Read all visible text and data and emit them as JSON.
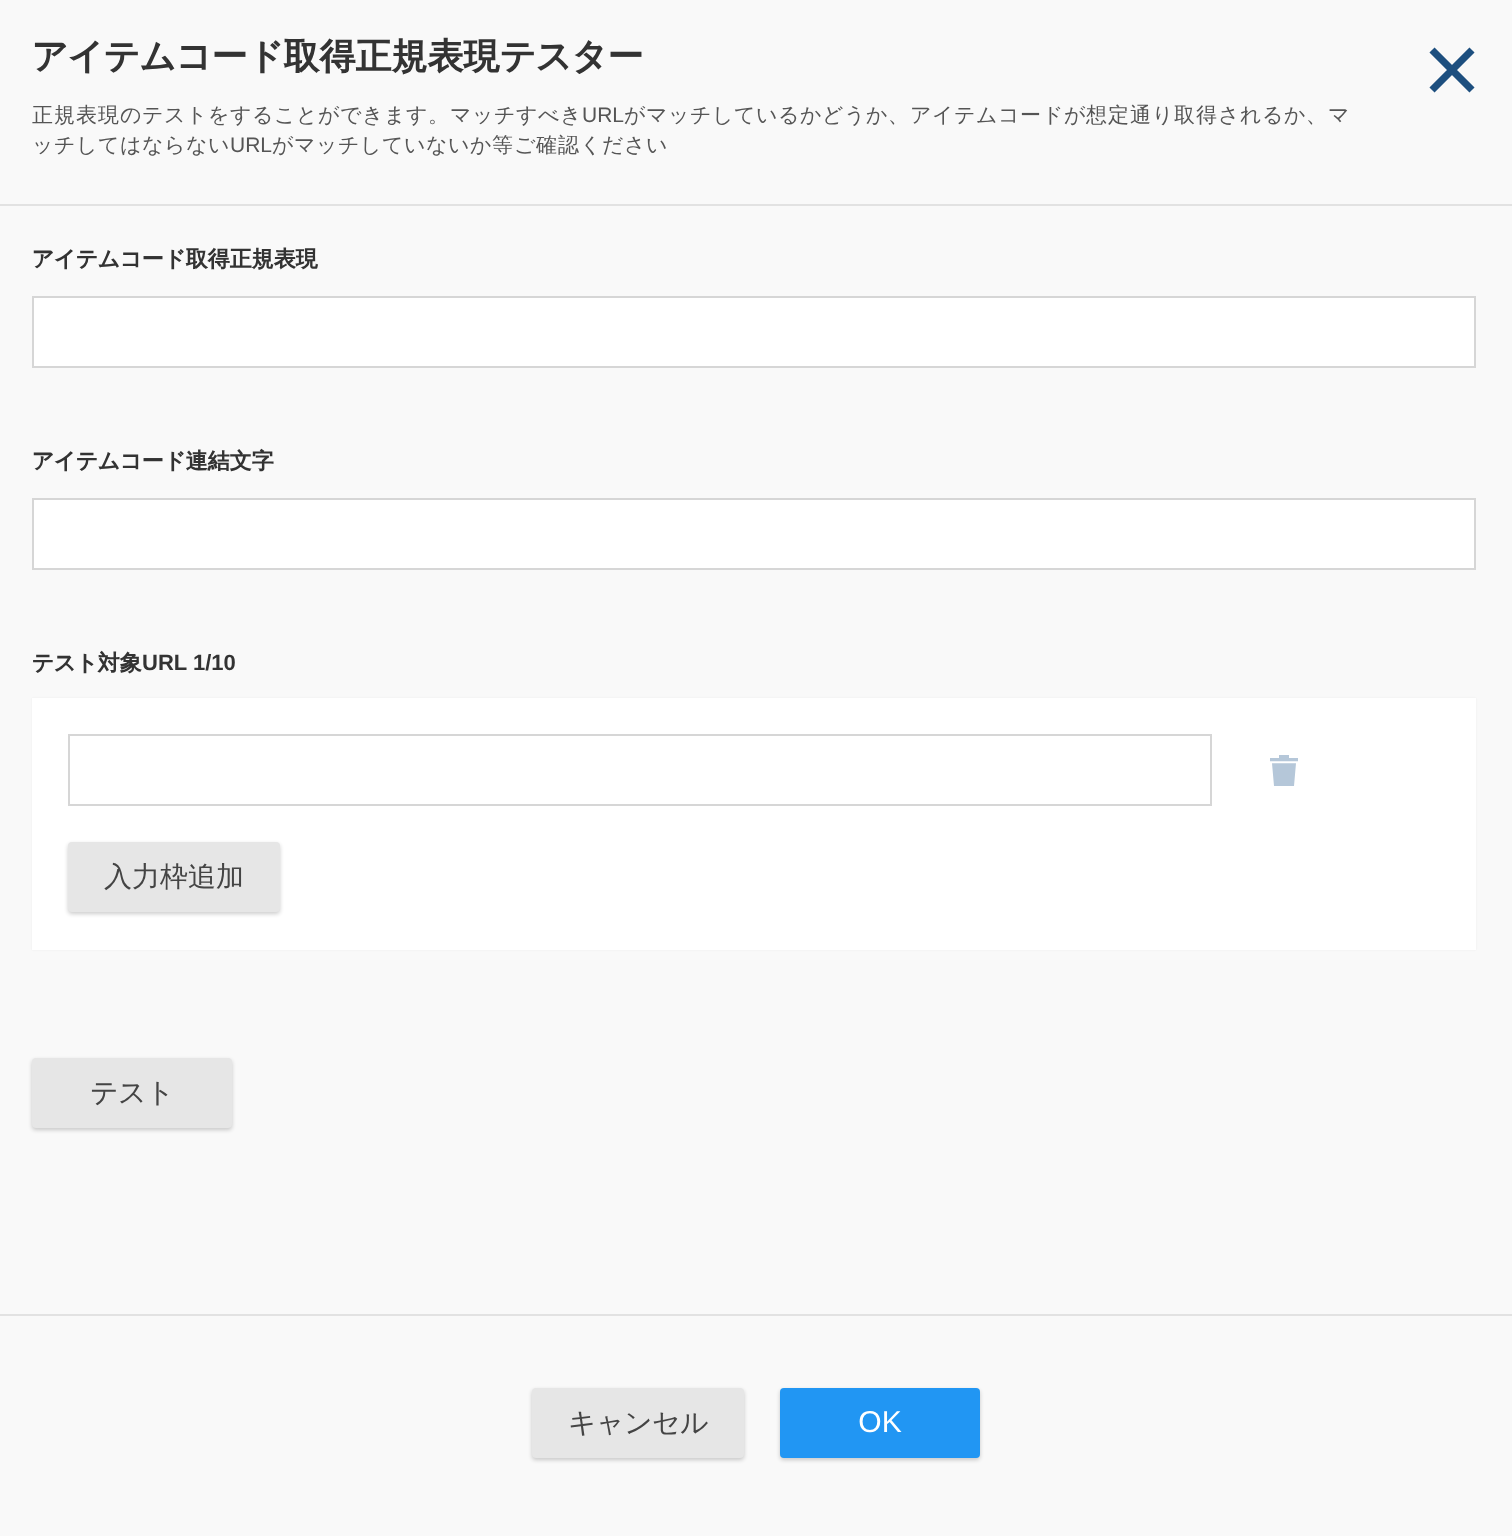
{
  "dialog": {
    "title": "アイテムコード取得正規表現テスター",
    "description": "正規表現のテストをすることができます。マッチすべきURLがマッチしているかどうか、アイテムコードが想定通り取得されるか、マッチしてはならないURLがマッチしていないか等ご確認ください"
  },
  "fields": [
    {
      "label": "アイテムコード取得正規表現"
    },
    {
      "label": "アイテムコード連結文字"
    }
  ],
  "test_urls": {
    "label": "テスト対象URL 1/10",
    "add_button": "入力枠追加"
  },
  "test_button": "テスト",
  "footer_buttons": [
    {
      "label": "キャンセル",
      "kind": "secondary"
    },
    {
      "label": "OK",
      "kind": "primary"
    }
  ]
}
